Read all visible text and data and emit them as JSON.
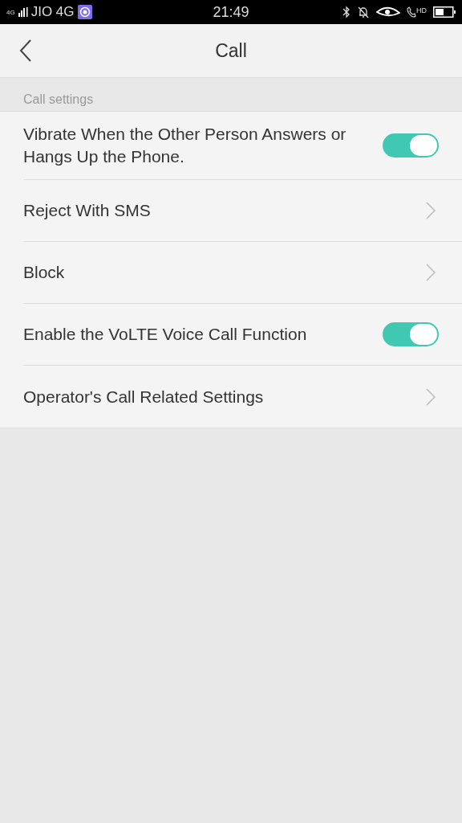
{
  "status_bar": {
    "network_type": "4G",
    "carrier": "JIO 4G",
    "time": "21:49",
    "hd_label": "HD"
  },
  "header": {
    "title": "Call"
  },
  "section": {
    "title": "Call settings"
  },
  "rows": [
    {
      "kind": "toggle",
      "label": "Vibrate When the Other Person Answers or Hangs Up the Phone.",
      "on": true
    },
    {
      "kind": "link",
      "label": "Reject With SMS"
    },
    {
      "kind": "link",
      "label": "Block"
    },
    {
      "kind": "toggle",
      "label": "Enable the VoLTE Voice Call Function",
      "on": true
    },
    {
      "kind": "link",
      "label": "Operator's Call Related Settings"
    }
  ]
}
